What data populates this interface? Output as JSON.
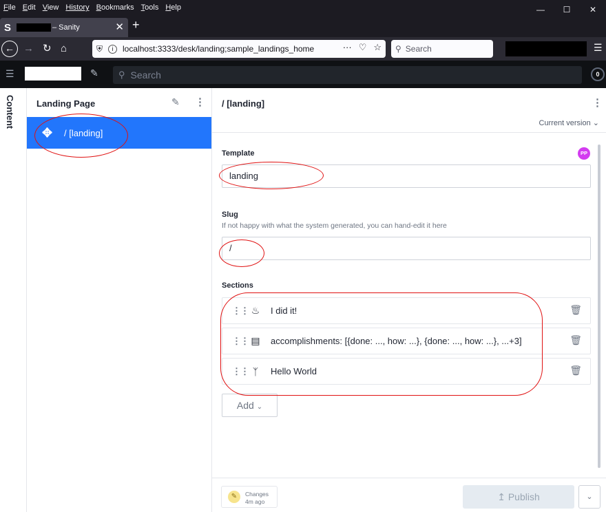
{
  "browser": {
    "menu": [
      {
        "u": "F",
        "rest": "ile"
      },
      {
        "u": "E",
        "rest": "dit"
      },
      {
        "u": "V",
        "rest": "iew"
      },
      {
        "u": "",
        "rest": "History"
      },
      {
        "u": "B",
        "rest": "ookmarks"
      },
      {
        "u": "T",
        "rest": "ools"
      },
      {
        "u": "H",
        "rest": "elp"
      }
    ],
    "tab_favicon": "S",
    "tab_title": "– Sanity",
    "url": "localhost:3333/desk/landing;sample_landings_home",
    "search_placeholder": "Search"
  },
  "sanity": {
    "search_placeholder": "Search",
    "notif_count": "0"
  },
  "rail": {
    "label": "Content"
  },
  "list": {
    "title": "Landing Page",
    "items": [
      {
        "label": "/ [landing]"
      }
    ]
  },
  "editor": {
    "title": "/ [landing]",
    "version": "Current version",
    "presence": "PP",
    "template": {
      "label": "Template",
      "value": "landing"
    },
    "slug": {
      "label": "Slug",
      "description": "If not happy with what the system generated, you can hand-edit it here",
      "value": "/"
    },
    "sections": {
      "label": "Sections",
      "items": [
        {
          "icon": "cake-icon",
          "text": "I did it!"
        },
        {
          "icon": "server-icon",
          "text": "accomplishments: [{done: ..., how: ...}, {done: ..., how: ...}, ...+3]"
        },
        {
          "icon": "bluetooth-icon",
          "text": "Hello World"
        }
      ],
      "add_label": "Add"
    },
    "footer": {
      "changes_label": "Changes",
      "changes_time": "4m ago",
      "publish_label": "Publish"
    }
  },
  "colors": {
    "accent": "#2276fc",
    "annotation": "#e01010",
    "presence": "#d33cf0"
  }
}
